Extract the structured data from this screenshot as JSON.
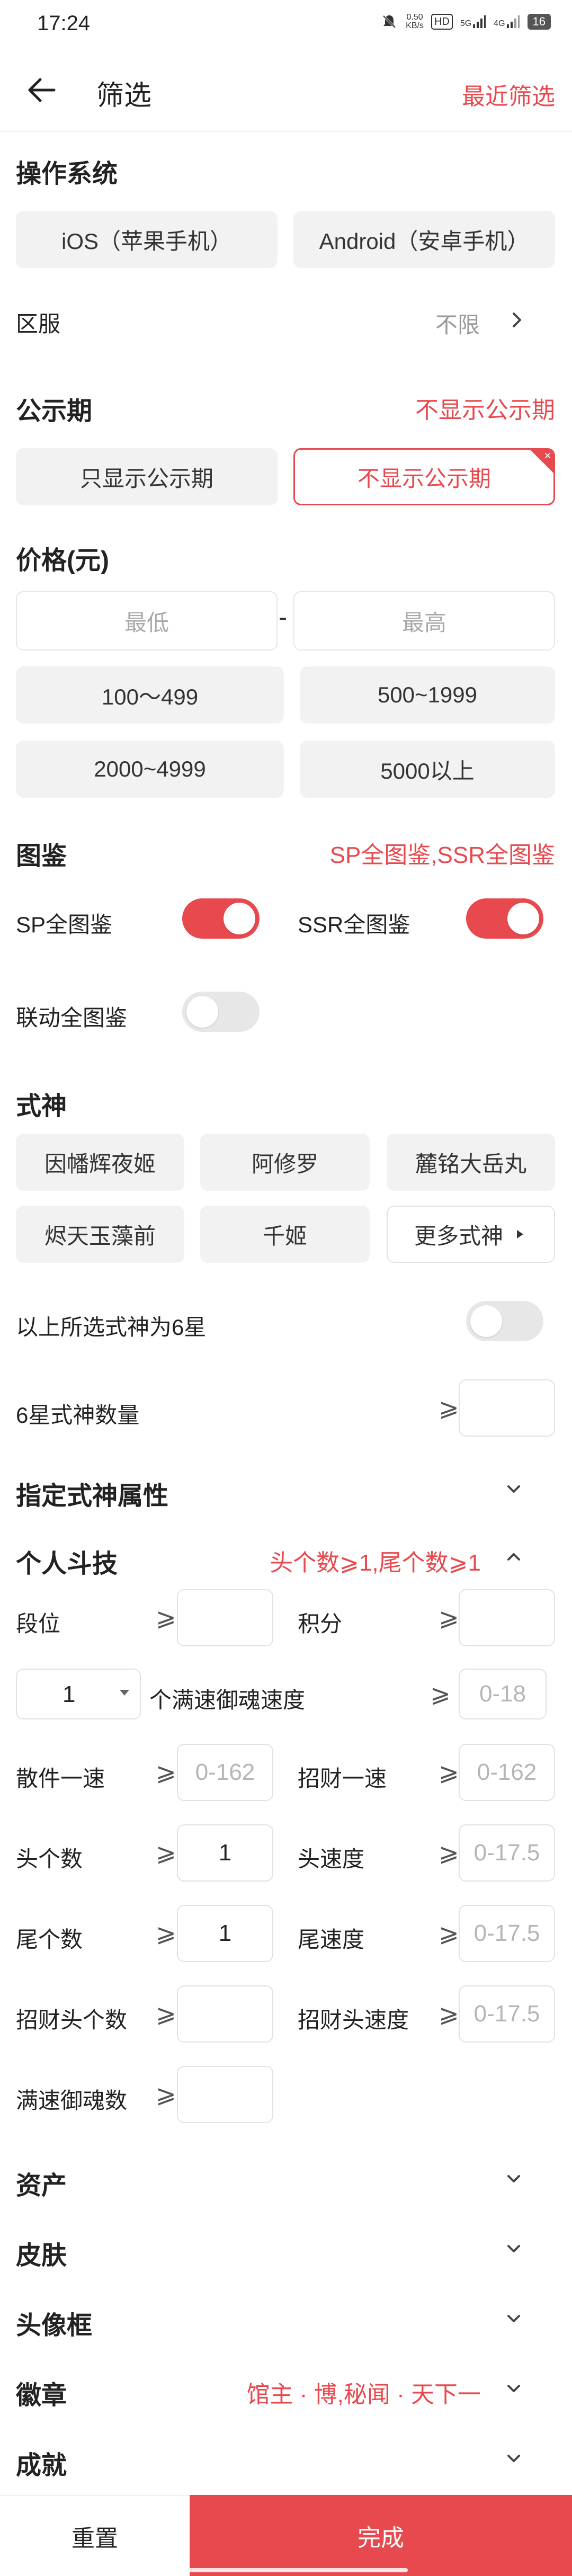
{
  "status_bar": {
    "time": "17:24",
    "speed": "0.50",
    "speed_unit": "KB/s",
    "hd": "HD",
    "net1": "5G",
    "net2": "4G",
    "battery": "16"
  },
  "header": {
    "title": "筛选",
    "recent": "最近筛选"
  },
  "os": {
    "title": "操作系统",
    "options": [
      "iOS（苹果手机）",
      "Android（安卓手机）"
    ]
  },
  "server": {
    "label": "区服",
    "value": "不限"
  },
  "publicity": {
    "title": "公示期",
    "summary": "不显示公示期",
    "options": [
      "只显示公示期",
      "不显示公示期"
    ],
    "selected_index": 1,
    "corner_mark": "×"
  },
  "price": {
    "title": "价格(元)",
    "min_placeholder": "最低",
    "max_placeholder": "最高",
    "dash": "-",
    "ranges": [
      "100～499",
      "500~1999",
      "2000~4999",
      "5000以上"
    ]
  },
  "illustration": {
    "title": "图鉴",
    "summary": "SP全图鉴,SSR全图鉴",
    "sp_label": "SP全图鉴",
    "sp_on": true,
    "ssr_label": "SSR全图鉴",
    "ssr_on": true,
    "collab_label": "联动全图鉴",
    "collab_on": false
  },
  "shikigami": {
    "title": "式神",
    "options": [
      "因幡辉夜姬",
      "阿修罗",
      "麓铭大岳丸",
      "烬天玉藻前",
      "千姬"
    ],
    "more": "更多式神",
    "six_star_label": "以上所选式神为6星",
    "six_star_on": false,
    "six_star_count_label": "6星式神数量",
    "ge": "⩾"
  },
  "attributes": {
    "title": "指定式神属性"
  },
  "battle": {
    "title": "个人斗技",
    "summary": "头个数⩾1,尾个数⩾1",
    "rank_label": "段位",
    "score_label": "积分",
    "select_value": "1",
    "speed_label": "个满速御魂速度",
    "speed_placeholder": "0-18",
    "sanjian_label": "散件一速",
    "sanjian_placeholder": "0-162",
    "zhaocai_label": "招财一速",
    "zhaocai_placeholder": "0-162",
    "head_count_label": "头个数",
    "head_count_value": "1",
    "head_speed_label": "头速度",
    "head_speed_placeholder": "0-17.5",
    "tail_count_label": "尾个数",
    "tail_count_value": "1",
    "tail_speed_label": "尾速度",
    "tail_speed_placeholder": "0-17.5",
    "zc_head_count_label": "招财头个数",
    "zc_head_speed_label": "招财头速度",
    "zc_head_speed_placeholder": "0-17.5",
    "full_speed_count_label": "满速御魂数"
  },
  "collapsed": {
    "assets": "资产",
    "skins": "皮肤",
    "avatar_frame": "头像框",
    "badge": "徽章",
    "badge_summary": "馆主 · 博,秘闻 · 天下一",
    "achievement": "成就"
  },
  "footer": {
    "reset": "重置",
    "done": "完成"
  },
  "colors": {
    "accent": "#e8494e",
    "button_bg": "#f2f2f2",
    "toggle_off": "#e7e7e7"
  }
}
